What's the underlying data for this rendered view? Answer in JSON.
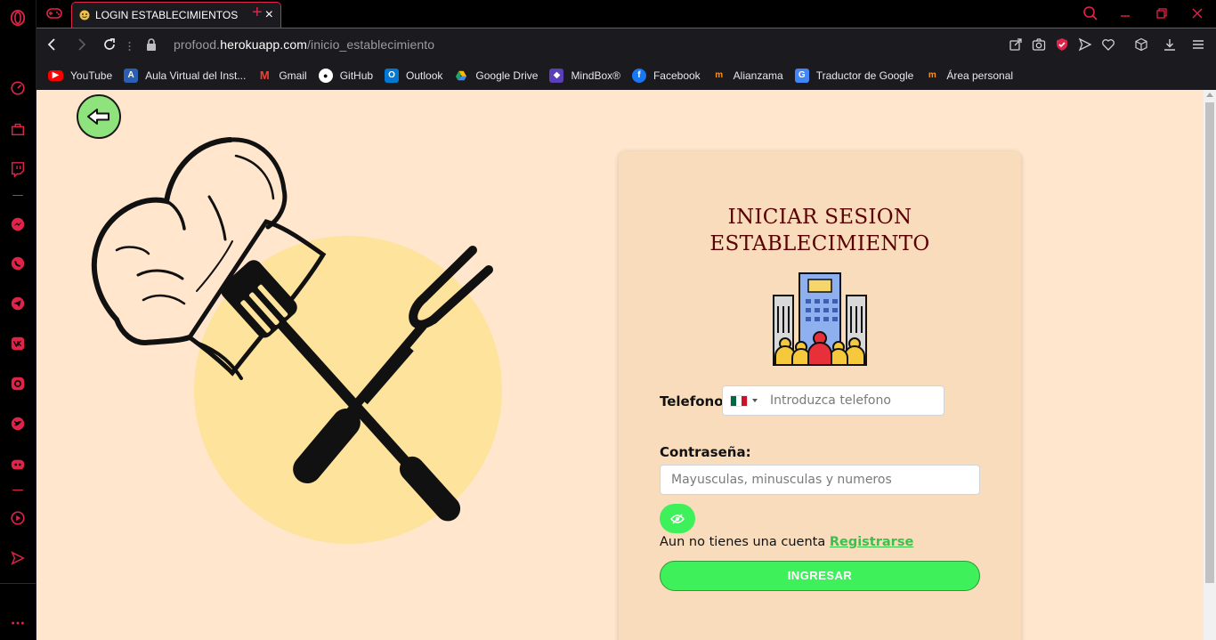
{
  "browser": {
    "tab_title": "LOGIN ESTABLECIMIENTOS",
    "tab_close": "×",
    "new_tab": "+",
    "url_prefix": "profood.",
    "url_host": "herokuapp.com",
    "url_path": "/inicio_establecimiento"
  },
  "bookmarks": [
    {
      "label": "YouTube",
      "icon": "youtube-icon",
      "color": "#ff0000"
    },
    {
      "label": "Aula Virtual del Inst...",
      "icon": "aula-icon",
      "color": "#2b5fb3"
    },
    {
      "label": "Gmail",
      "icon": "gmail-icon",
      "color": "#ea4335"
    },
    {
      "label": "GitHub",
      "icon": "github-icon",
      "color": "#ffffff"
    },
    {
      "label": "Outlook",
      "icon": "outlook-icon",
      "color": "#0078d4"
    },
    {
      "label": "Google Drive",
      "icon": "drive-icon",
      "color": "#1fa463"
    },
    {
      "label": "MindBox®",
      "icon": "mindbox-icon",
      "color": "#5b3fb8"
    },
    {
      "label": "Facebook",
      "icon": "facebook-icon",
      "color": "#1877f2"
    },
    {
      "label": "Alianzama",
      "icon": "alianzama-icon",
      "color": "#f7931e"
    },
    {
      "label": "Traductor de Google",
      "icon": "translate-icon",
      "color": "#4285f4"
    },
    {
      "label": "Área personal",
      "icon": "area-personal-icon",
      "color": "#f7931e"
    }
  ],
  "login": {
    "title_line1": "INICIAR SESION",
    "title_line2": "ESTABLECIMIENTO",
    "phone_label": "Telefono:",
    "phone_placeholder": "Introduzca telefono",
    "password_label": "Contraseña:",
    "password_placeholder": "Mayusculas, minusculas y numeros",
    "no_account_text": "Aun no tienes una cuenta",
    "register_link": "Registrarse",
    "submit_label": "INGRESAR"
  },
  "colors": {
    "accent": "#e02348",
    "page_bg": "#ffe6cd",
    "card_bg": "#f8dcbb",
    "title": "#5a0000",
    "button_green": "#3ef05a"
  }
}
